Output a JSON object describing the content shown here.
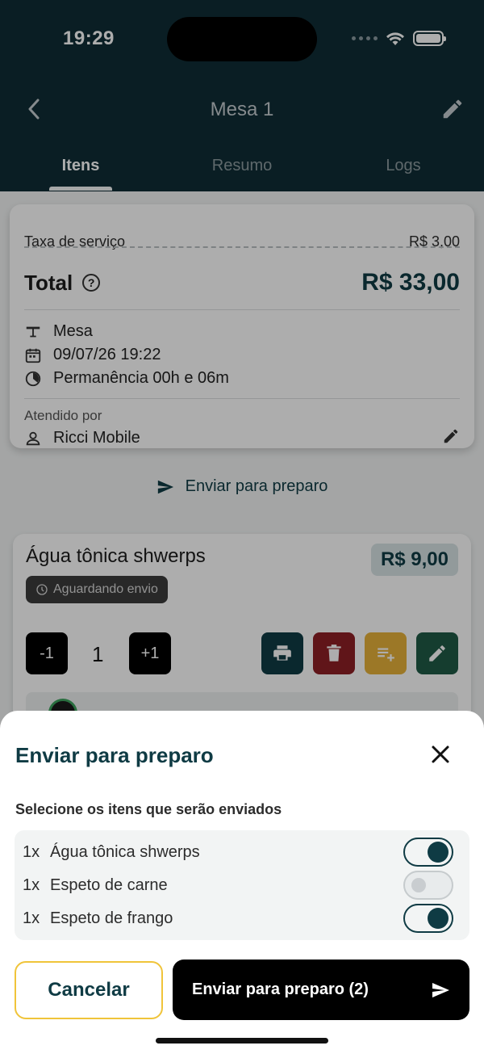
{
  "status_bar": {
    "time": "19:29"
  },
  "nav": {
    "title": "Mesa 1"
  },
  "tabs": [
    {
      "label": "Itens"
    },
    {
      "label": "Resumo"
    },
    {
      "label": "Logs"
    }
  ],
  "summary": {
    "service_fee_label": "Taxa de serviço",
    "service_fee_value": "R$ 3,00",
    "total_label": "Total",
    "total_help_icon": "?",
    "total_value": "R$ 33,00",
    "table_label": "Mesa",
    "datetime": "09/07/26 19:22",
    "stay": "Permanência 00h e 06m",
    "served_by_label": "Atendido por",
    "served_by": "Ricci Mobile"
  },
  "send_link": {
    "label": "Enviar para preparo"
  },
  "item": {
    "name": "Água tônica shwerps",
    "price": "R$ 9,00",
    "status": "Aguardando envio",
    "minus": "-1",
    "quantity": "1",
    "plus": "+1"
  },
  "sheet": {
    "title": "Enviar para preparo",
    "instruction": "Selecione os itens que serão enviados",
    "items": [
      {
        "qty": "1x",
        "name": "Água tônica shwerps",
        "selected": true
      },
      {
        "qty": "1x",
        "name": "Espeto de carne",
        "selected": false
      },
      {
        "qty": "1x",
        "name": "Espeto de frango",
        "selected": true
      }
    ],
    "cancel_label": "Cancelar",
    "send_label": "Enviar para preparo (2)"
  },
  "colors": {
    "header_bg": "#0f2d35",
    "primary": "#0f3b44",
    "print_btn": "#0f3b44",
    "delete_btn": "#8e1f25",
    "add_btn": "#e6b23a",
    "edit_btn": "#1f5a46",
    "cancel_border": "#f0c43a"
  }
}
